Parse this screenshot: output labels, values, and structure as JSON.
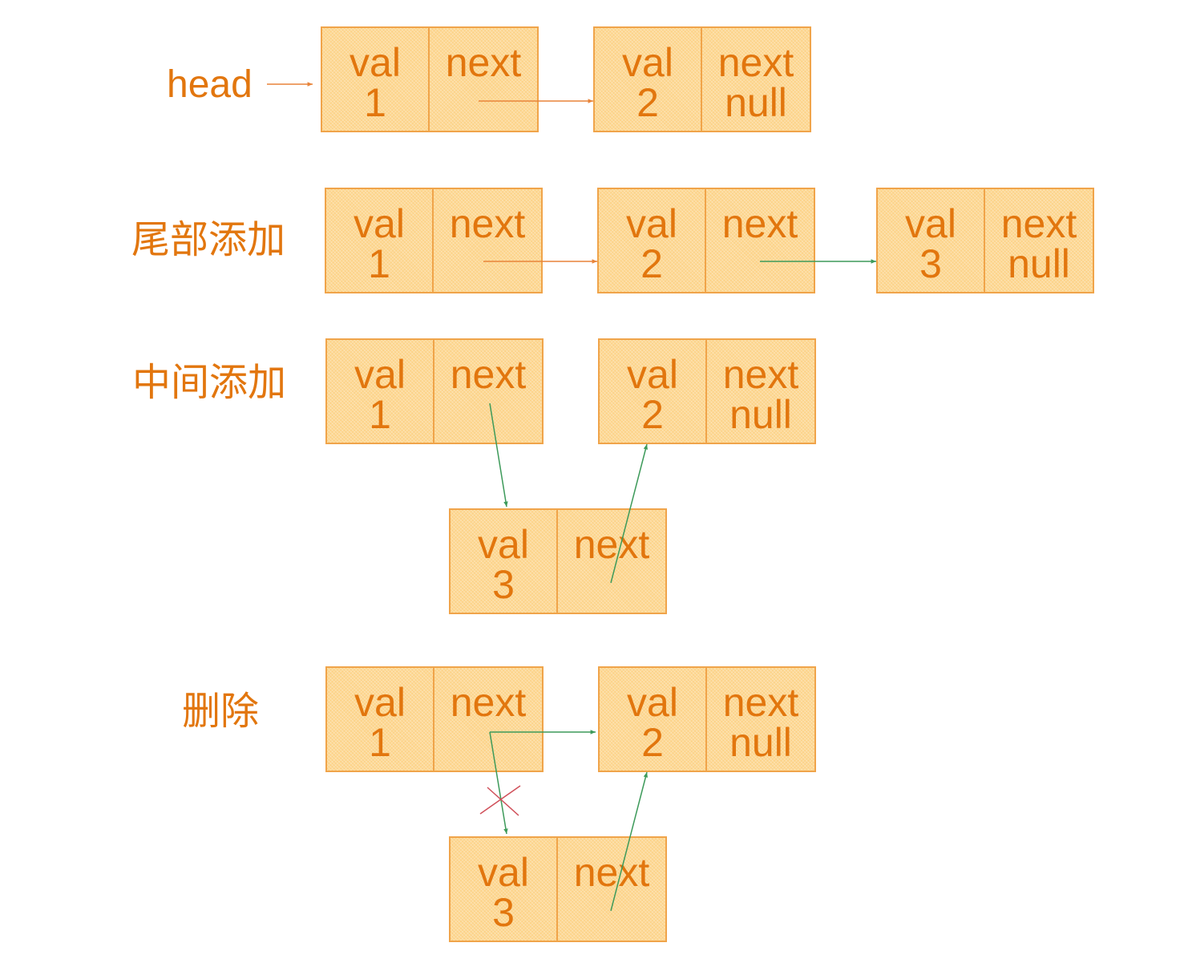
{
  "labels": [
    "head",
    "尾部添加",
    "中间添加",
    "删除"
  ],
  "colors": {
    "text": "#e2760e",
    "fill": "#fcd389",
    "border": "#f0a44a",
    "arrow_orange": "#e8843a",
    "arrow_green": "#3d9a5a",
    "cross_red": "#d0505a"
  },
  "nodes": [
    {
      "val_label": "val",
      "val": "1",
      "next_label": "next",
      "next_value": ""
    },
    {
      "val_label": "val",
      "val": "2",
      "next_label": "next",
      "next_value": "null"
    },
    {
      "val_label": "val",
      "val": "1",
      "next_label": "next",
      "next_value": ""
    },
    {
      "val_label": "val",
      "val": "2",
      "next_label": "next",
      "next_value": ""
    },
    {
      "val_label": "val",
      "val": "3",
      "next_label": "next",
      "next_value": "null"
    },
    {
      "val_label": "val",
      "val": "1",
      "next_label": "next",
      "next_value": ""
    },
    {
      "val_label": "val",
      "val": "2",
      "next_label": "next",
      "next_value": "null"
    },
    {
      "val_label": "val",
      "val": "3",
      "next_label": "next",
      "next_value": ""
    },
    {
      "val_label": "val",
      "val": "1",
      "next_label": "next",
      "next_value": ""
    },
    {
      "val_label": "val",
      "val": "2",
      "next_label": "next",
      "next_value": "null"
    },
    {
      "val_label": "val",
      "val": "3",
      "next_label": "next",
      "next_value": ""
    }
  ]
}
